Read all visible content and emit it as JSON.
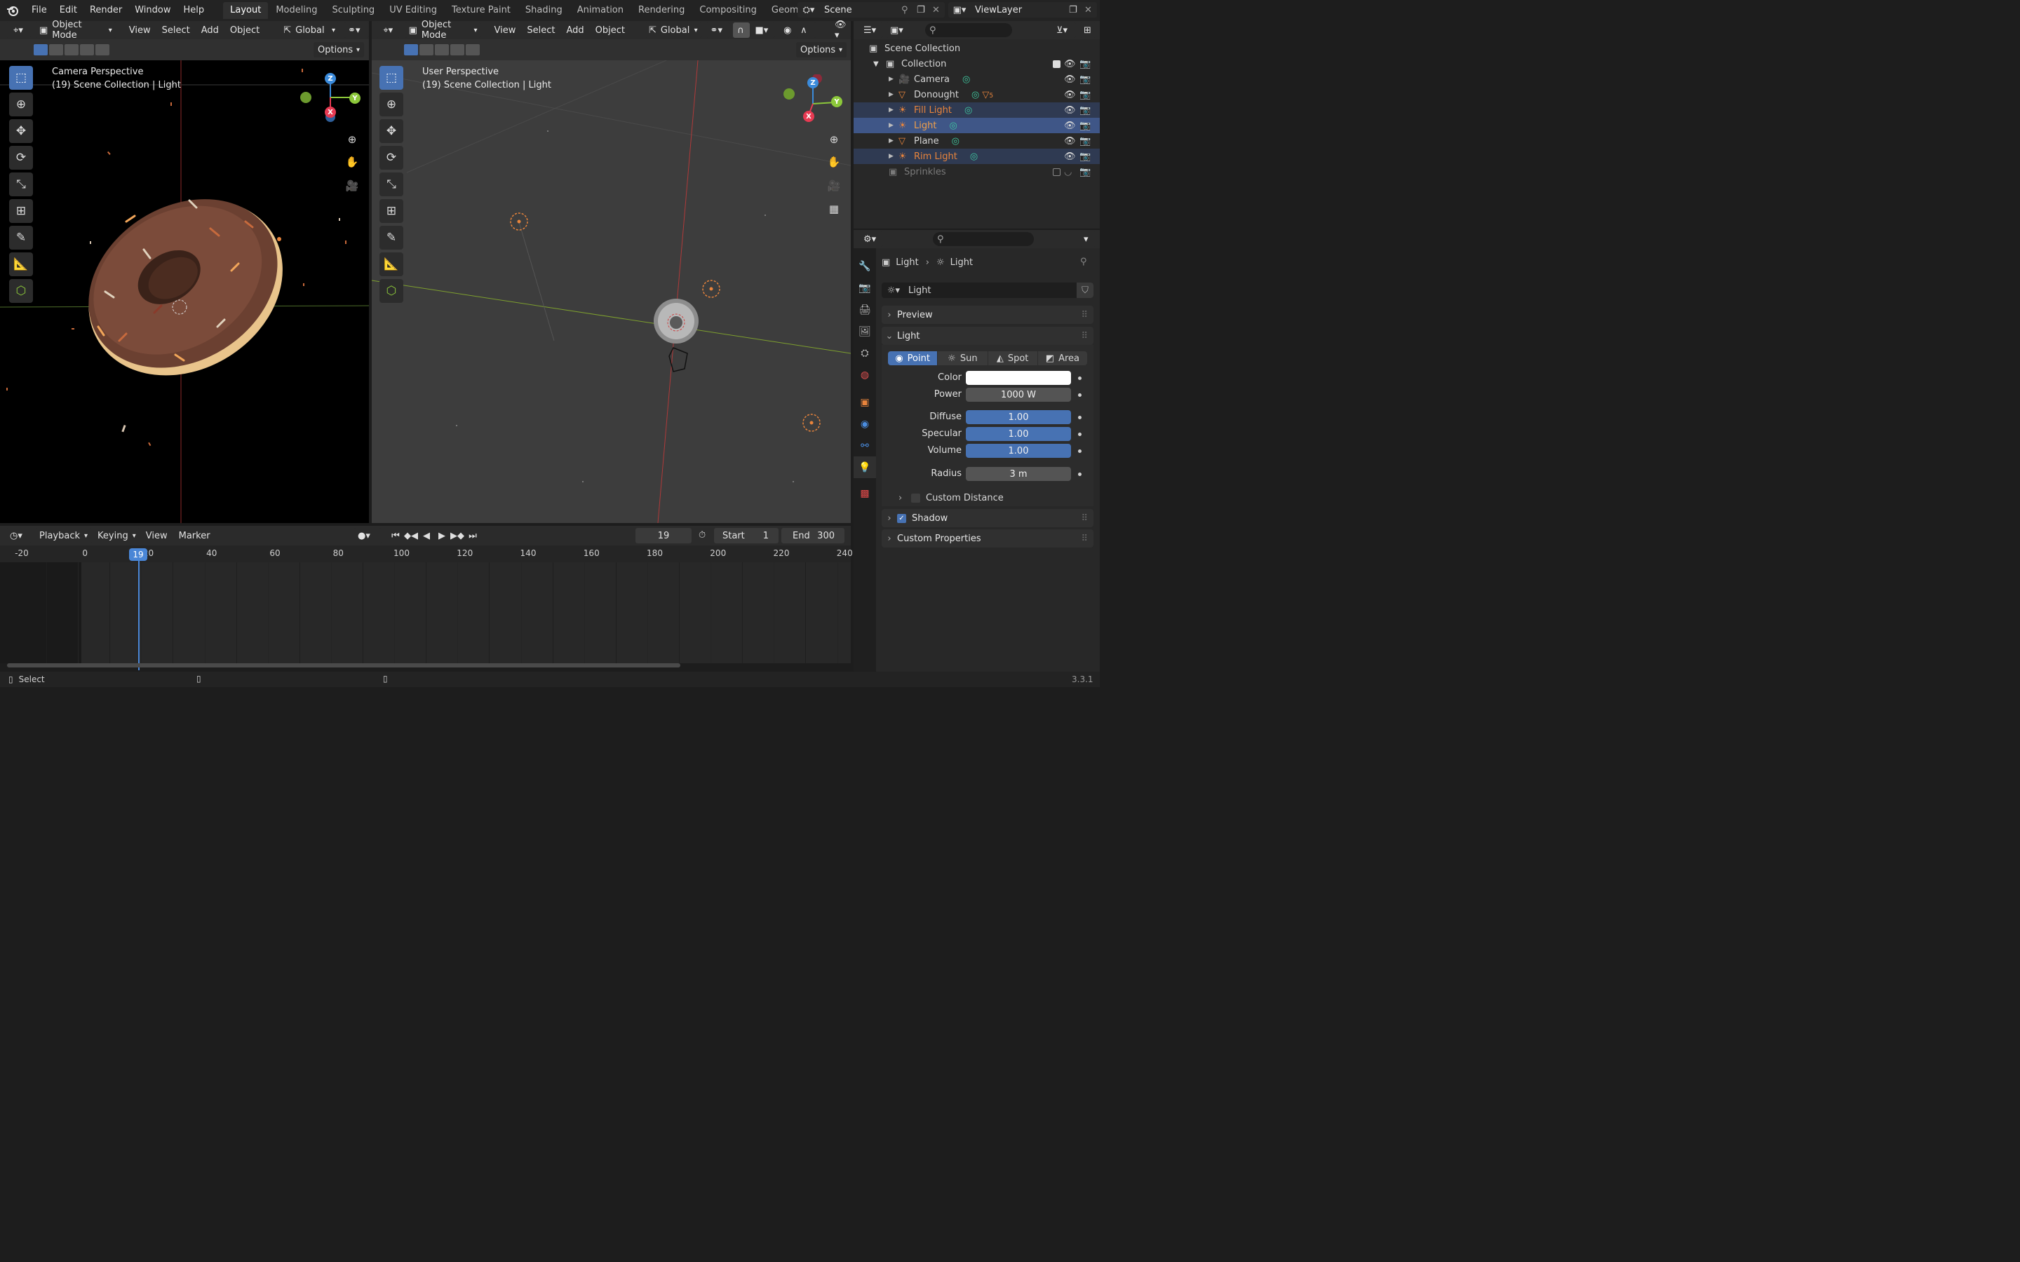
{
  "app": {
    "menus": [
      "File",
      "Edit",
      "Render",
      "Window",
      "Help"
    ],
    "workspaces": [
      "Layout",
      "Modeling",
      "Sculpting",
      "UV Editing",
      "Texture Paint",
      "Shading",
      "Animation",
      "Rendering",
      "Compositing",
      "Geometry Nodes"
    ],
    "active_workspace": "Layout",
    "scene": "Scene",
    "view_layer": "ViewLayer"
  },
  "viewport_left": {
    "mode": "Object Mode",
    "menus": [
      "View",
      "Select",
      "Add",
      "Object"
    ],
    "transform": "Global",
    "options": "Options",
    "perspective": "Camera Perspective",
    "info": "(19) Scene Collection | Light"
  },
  "viewport_right": {
    "mode": "Object Mode",
    "menus": [
      "View",
      "Select",
      "Add",
      "Object"
    ],
    "transform": "Global",
    "options": "Options",
    "perspective": "User Perspective",
    "info": "(19) Scene Collection | Light"
  },
  "gizmo": {
    "x": "X",
    "y": "Y",
    "z": "Z"
  },
  "outliner": {
    "root": "Scene Collection",
    "collection": "Collection",
    "items": [
      {
        "name": "Camera",
        "icon": "camera-icon",
        "color": "#d6d6d6",
        "state": "normal"
      },
      {
        "name": "Donought",
        "icon": "mesh-icon",
        "color": "#d6d6d6",
        "state": "normal",
        "badge": "5"
      },
      {
        "name": "Fill Light",
        "icon": "light-icon",
        "color": "#e8843c",
        "state": "selected"
      },
      {
        "name": "Light",
        "icon": "light-icon",
        "color": "#f2a04a",
        "state": "active"
      },
      {
        "name": "Plane",
        "icon": "mesh-icon",
        "color": "#d6d6d6",
        "state": "normal"
      },
      {
        "name": "Rim Light",
        "icon": "light-icon",
        "color": "#e8843c",
        "state": "selected"
      }
    ],
    "sprinkles": "Sprinkles"
  },
  "properties": {
    "breadcrumb_object": "Light",
    "breadcrumb_data": "Light",
    "datablock": "Light",
    "panels": {
      "preview": "Preview",
      "light": "Light",
      "custom_distance": "Custom Distance",
      "shadow": "Shadow",
      "custom_properties": "Custom Properties"
    },
    "light_types": [
      "Point",
      "Sun",
      "Spot",
      "Area"
    ],
    "active_light_type": "Point",
    "color_label": "Color",
    "color_value": "#ffffff",
    "fields": [
      {
        "label": "Power",
        "value": "1000 W",
        "style": "plain"
      },
      {
        "label": "Diffuse",
        "value": "1.00",
        "style": "slider"
      },
      {
        "label": "Specular",
        "value": "1.00",
        "style": "slider"
      },
      {
        "label": "Volume",
        "value": "1.00",
        "style": "slider"
      },
      {
        "label": "Radius",
        "value": "3 m",
        "style": "plain"
      }
    ]
  },
  "timeline": {
    "menus": [
      "Playback",
      "Keying",
      "View",
      "Marker"
    ],
    "current_frame": "19",
    "start_label": "Start",
    "start": "1",
    "end_label": "End",
    "end": "300",
    "ruler": [
      "-20",
      "0",
      "20",
      "40",
      "60",
      "80",
      "100",
      "120",
      "140",
      "160",
      "180",
      "200",
      "220",
      "240"
    ]
  },
  "status": {
    "left": "Select",
    "version": "3.3.1"
  },
  "colors": {
    "accent": "#4772b3",
    "axis_x": "#e83a52",
    "axis_y": "#8cc83a",
    "axis_z": "#3b8bdb",
    "light_orange": "#e8843c"
  }
}
